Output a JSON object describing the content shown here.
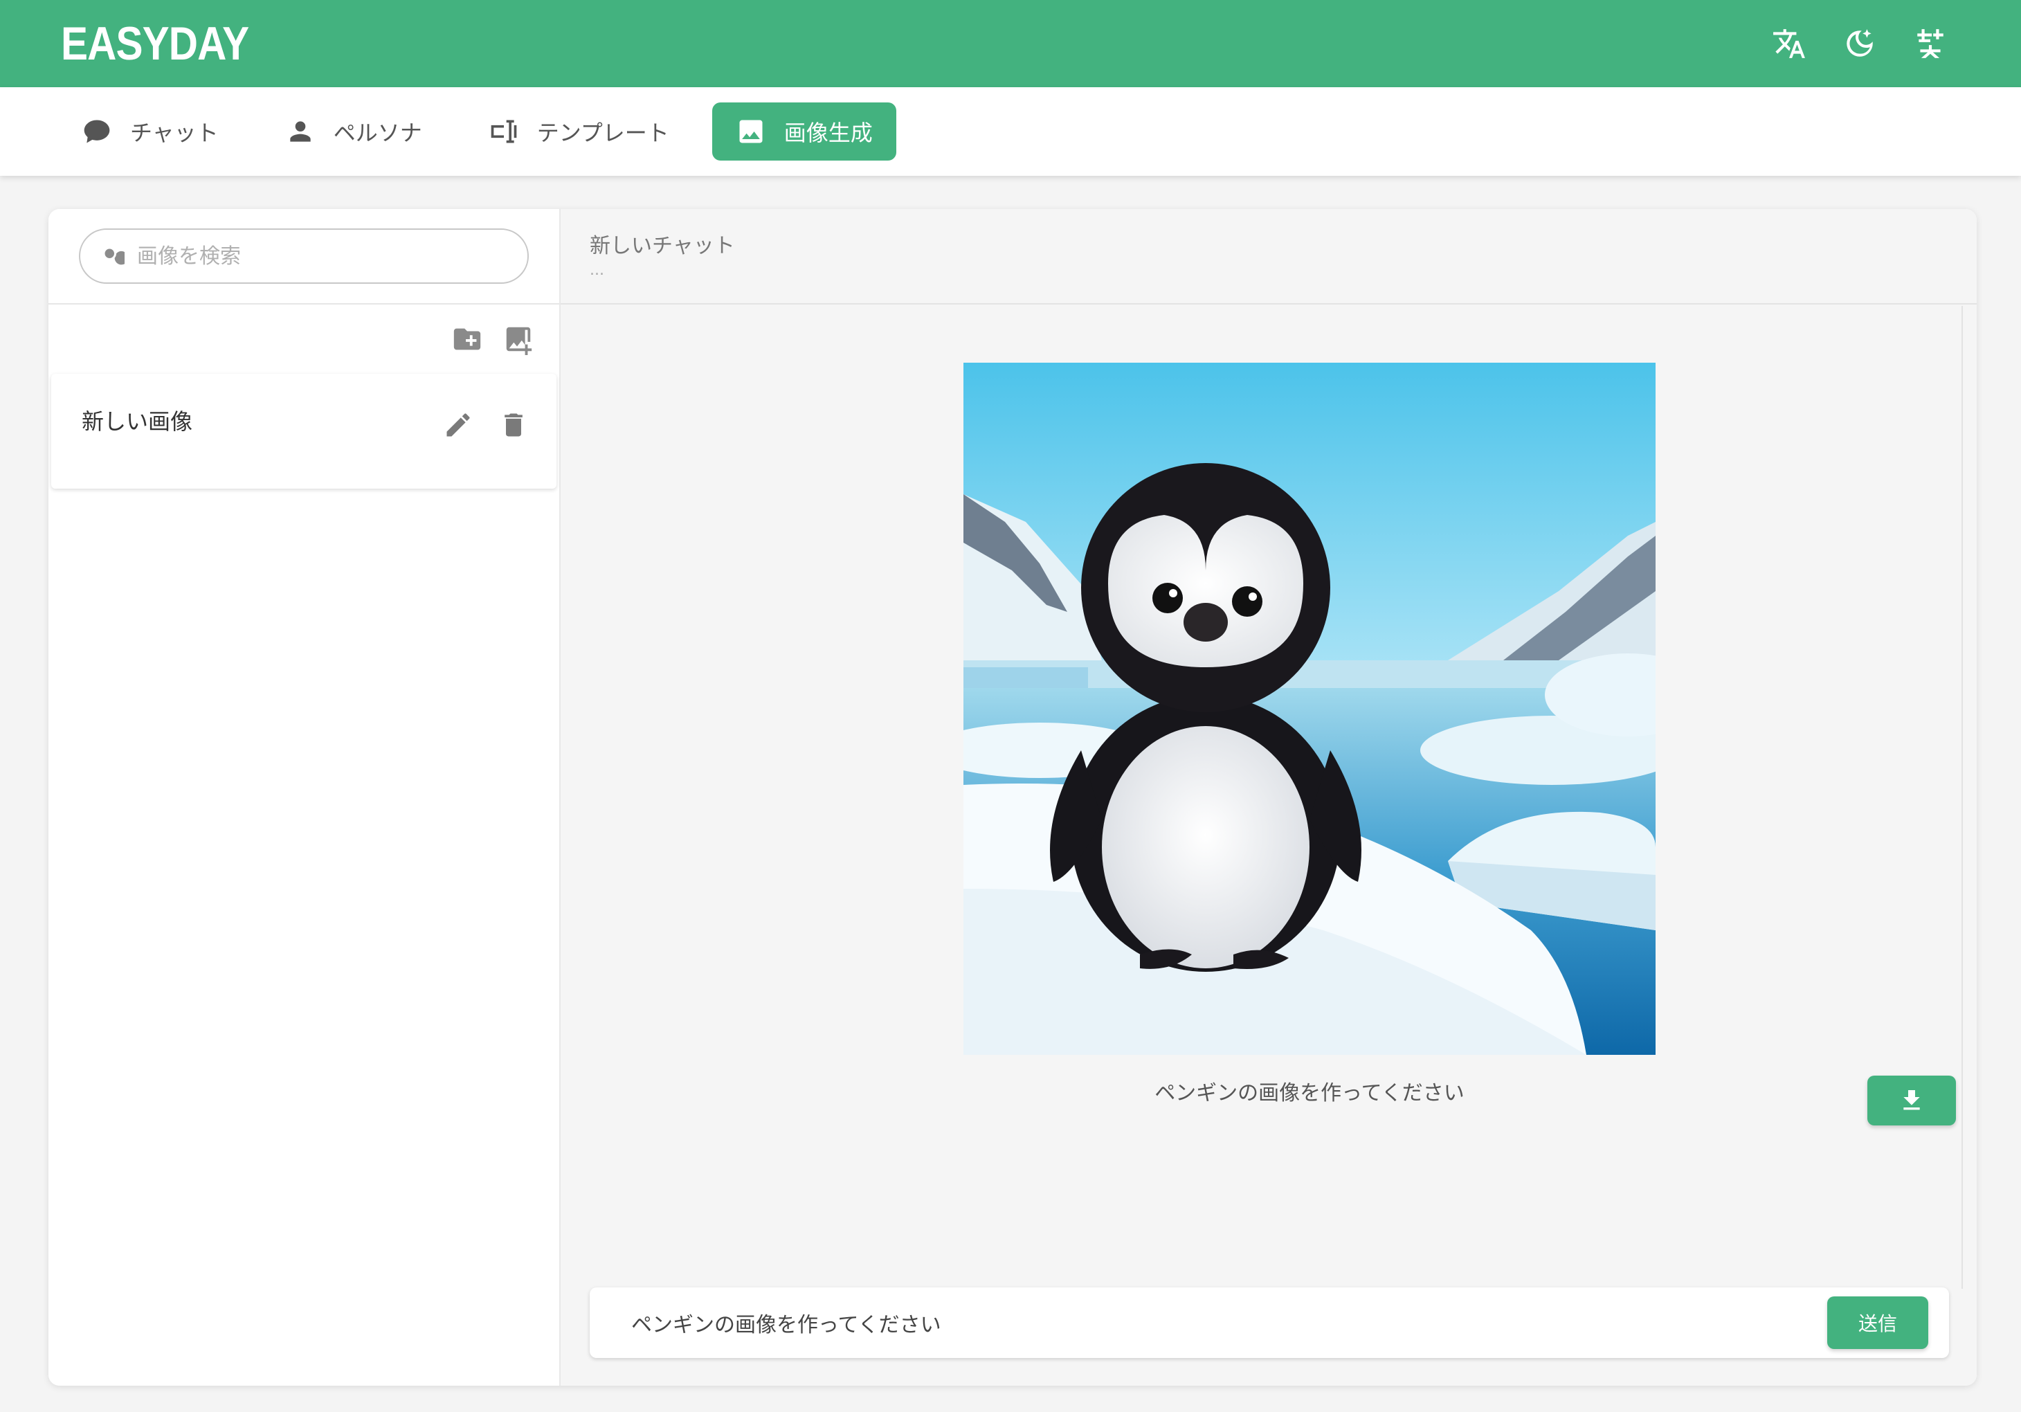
{
  "app": {
    "brand": "EASYDAY"
  },
  "header": {
    "actions": [
      {
        "icon": "translate-icon"
      },
      {
        "icon": "dark-mode-icon"
      },
      {
        "icon": "font-size-icon"
      }
    ]
  },
  "tabs": [
    {
      "label": "チャット",
      "icon": "chat-bubble-icon",
      "active": false
    },
    {
      "label": "ペルソナ",
      "icon": "person-icon",
      "active": false
    },
    {
      "label": "テンプレート",
      "icon": "template-icon",
      "active": false
    },
    {
      "label": "画像生成",
      "icon": "image-icon",
      "active": true
    }
  ],
  "sidebar": {
    "search": {
      "placeholder": "画像を検索",
      "value": ""
    },
    "tools": [
      {
        "icon": "new-folder-icon"
      },
      {
        "icon": "add-image-icon"
      }
    ],
    "items": [
      {
        "label": "新しい画像"
      }
    ]
  },
  "main": {
    "title": "新しいチャット",
    "subtitle": "...",
    "image_caption": "ペンギンの画像を作ってください",
    "image_subject": "penguin-image",
    "composer": {
      "value": "ペンギンの画像を作ってください",
      "send_label": "送信"
    }
  },
  "colors": {
    "accent": "#43b27f",
    "background": "#f4f4f4"
  }
}
